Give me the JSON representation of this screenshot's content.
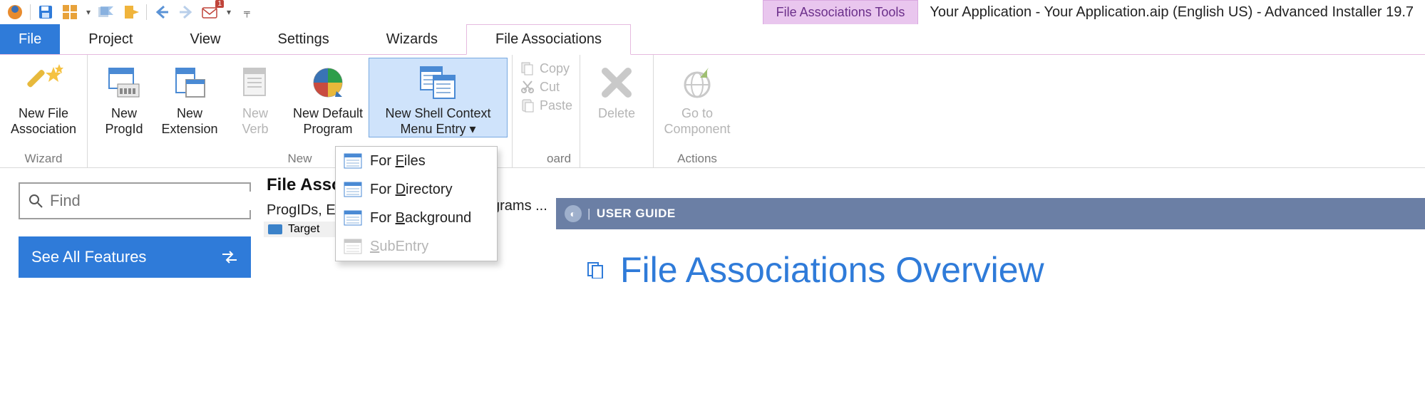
{
  "title_bar": {
    "context_tools": "File Associations Tools",
    "title": "Your Application - Your Application.aip (English US) - Advanced Installer 19.7"
  },
  "qat": {
    "envelope_badge": "1"
  },
  "menu": {
    "file": "File",
    "project": "Project",
    "view": "View",
    "settings": "Settings",
    "wizards": "Wizards",
    "file_assoc": "File Associations"
  },
  "ribbon": {
    "groups": {
      "wizard": "Wizard",
      "new": "New",
      "clipboard_suffix": "oard",
      "actions": "Actions"
    },
    "buttons": {
      "new_file_assoc_l1": "New File",
      "new_file_assoc_l2": "Association",
      "new_progid_l1": "New",
      "new_progid_l2": "ProgId",
      "new_ext_l1": "New",
      "new_ext_l2": "Extension",
      "new_verb_l1": "New",
      "new_verb_l2": "Verb",
      "new_default_l1": "New Default",
      "new_default_l2": "Program",
      "new_shell_l1": "New Shell Context",
      "new_shell_l2": "Menu Entry",
      "copy": "Copy",
      "cut": "Cut",
      "paste": "Paste",
      "delete": "Delete",
      "goto_l1": "Go to",
      "goto_l2": "Component"
    }
  },
  "popup": {
    "files_pre": "For ",
    "files_u": "F",
    "files_post": "iles",
    "dir_pre": "For ",
    "dir_u": "D",
    "dir_post": "irectory",
    "bg_pre": "For ",
    "bg_u": "B",
    "bg_post": "ackground",
    "sub_u": "S",
    "sub_post": "ubEntry"
  },
  "left": {
    "find_placeholder": "Find",
    "see_all": "See All Features"
  },
  "mid": {
    "title_frag": "File Asso",
    "sub_left": "ProgIDs, Ex",
    "sub_right": "grams ...",
    "target": "Target"
  },
  "right": {
    "guide": "USER GUIDE",
    "page_title": "File Associations Overview"
  }
}
